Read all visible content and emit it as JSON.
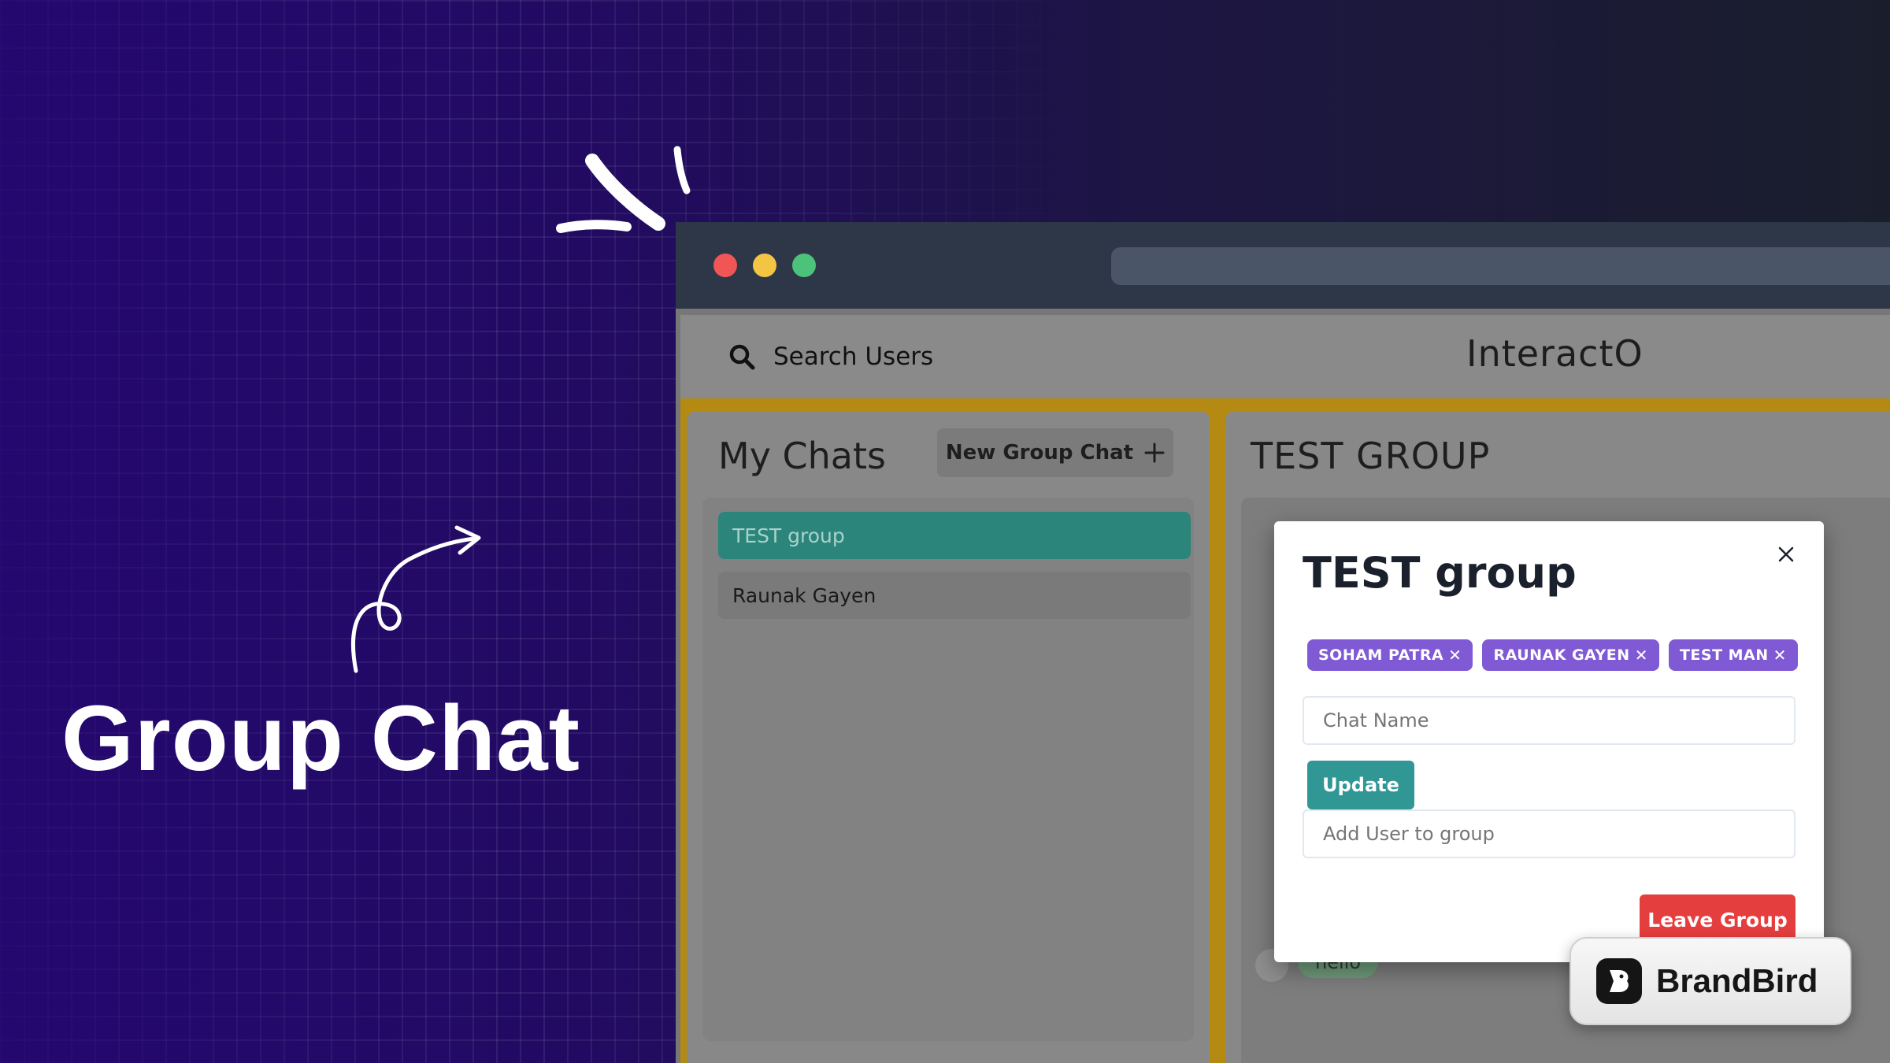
{
  "hero": {
    "title": "Group Chat"
  },
  "app": {
    "search_label": "Search Users",
    "brand_title": "InteractO",
    "my_chats": {
      "title": "My Chats",
      "new_group_label": "New Group Chat",
      "chats": [
        {
          "name": "TEST group",
          "active": true
        },
        {
          "name": "Raunak Gayen",
          "active": false
        }
      ]
    },
    "conversation": {
      "title": "TEST GROUP",
      "last_message": "hello"
    }
  },
  "modal": {
    "title": "TEST group",
    "members": [
      "SOHAM PATRA",
      "RAUNAK GAYEN",
      "TEST MAN"
    ],
    "chat_name_placeholder": "Chat Name",
    "update_label": "Update",
    "add_user_placeholder": "Add User to group",
    "leave_label": "Leave Group"
  },
  "badge": {
    "label": "BrandBird"
  },
  "colors": {
    "accent_teal": "#319795",
    "tag_purple": "#805ad5",
    "danger_red": "#e53e3e",
    "traffic_red": "#f05656",
    "traffic_yellow": "#f4c542",
    "traffic_green": "#4cc27a"
  }
}
